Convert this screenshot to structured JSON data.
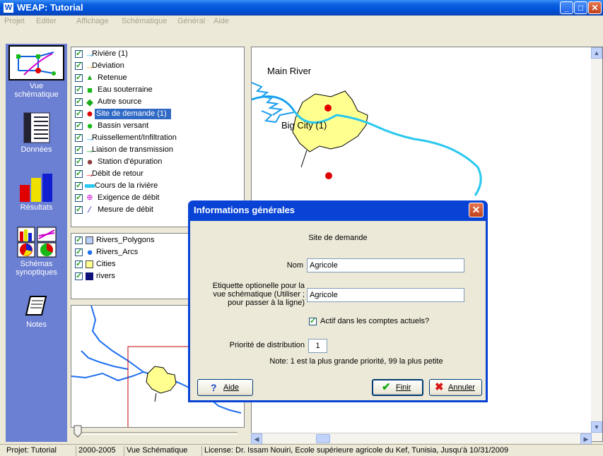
{
  "window": {
    "title": "WEAP: Tutorial",
    "icon_letter": "W"
  },
  "menu": [
    "Projet",
    "Editer",
    "Affichage",
    "Schématique",
    "Général",
    "Aide"
  ],
  "sidebar": [
    {
      "label_1": "Vue",
      "label_2": "schématique",
      "icon": "schematic-icon"
    },
    {
      "label_1": "Données",
      "icon": "data-icon"
    },
    {
      "label_1": "Résultats",
      "icon": "results-icon"
    },
    {
      "label_1": "Schémas",
      "label_2": "synoptiques",
      "icon": "overviews-icon"
    },
    {
      "label_1": "Notes",
      "icon": "notes-icon"
    }
  ],
  "legend": [
    {
      "label": "Rivière (1)",
      "symbol": "river-arrow-icon",
      "color": "#29a9f2"
    },
    {
      "label": "Déviation",
      "symbol": "diversion-arrow-icon",
      "color": "#f59a20"
    },
    {
      "label": "Retenue",
      "symbol": "reservoir-triangle-icon",
      "color": "#18a818"
    },
    {
      "label": "Eau souterraine",
      "symbol": "groundwater-square-icon",
      "color": "#18b818"
    },
    {
      "label": "Autre source",
      "symbol": "other-supply-diamond-icon",
      "color": "#18a818"
    },
    {
      "label": "Site de demande (1)",
      "symbol": "demand-site-dot-icon",
      "color": "#e00000",
      "selected": true
    },
    {
      "label": "Bassin versant",
      "symbol": "catchment-dot-icon",
      "color": "#18b818"
    },
    {
      "label": "Ruissellement/Infiltration",
      "symbol": "runoff-arrow-icon",
      "color": "#29a9f2"
    },
    {
      "label": "Liaison de transmission",
      "symbol": "transmission-arrow-icon",
      "color": "#18a818"
    },
    {
      "label": "Station d'épuration",
      "symbol": "treatment-dot-icon",
      "color": "#8b3a3a"
    },
    {
      "label": "Débit de retour",
      "symbol": "return-flow-arrow-icon",
      "color": "#e00000"
    },
    {
      "label": "Cours de la rivière",
      "symbol": "reach-bar-icon",
      "color": "#29c8f0"
    },
    {
      "label": "Exigence de débit",
      "symbol": "flow-requirement-icon",
      "color": "#d000d0"
    },
    {
      "label": "Mesure de débit",
      "symbol": "streamflow-gauge-icon",
      "color": "#1010c0"
    }
  ],
  "layers": [
    {
      "label": "Rivers_Polygons",
      "symbol": "polygon-square-icon",
      "color": "#b8d0f8"
    },
    {
      "label": "Rivers_Arcs",
      "symbol": "arc-dot-icon",
      "color": "#1e6ef0"
    },
    {
      "label": "Cities",
      "symbol": "city-square-icon",
      "color": "#ffff90"
    },
    {
      "label": "rivers",
      "symbol": "rivers-square-icon",
      "color": "#10107a"
    }
  ],
  "map": {
    "river_label": "Main River",
    "city_label": "Big City (1)"
  },
  "dialog": {
    "title": "Informations générales",
    "subtitle": "Site de demande",
    "name_label": "Nom",
    "name_value": "Agricole",
    "optional_label_1": "Etiquette optionelle pour la",
    "optional_label_2": "vue schématique (Utiliser ;",
    "optional_label_3": "pour passer à la ligne)",
    "optional_value": "Agricole",
    "active_label": "Actif dans les comptes actuels?",
    "priority_label": "Priorité de distribution",
    "priority_value": "1",
    "note": "Note: 1 est la plus grande priorité, 99 la plus petite",
    "help_button": "Aide",
    "ok_button": "Finir",
    "cancel_button": "Annuler"
  },
  "status": [
    "Projet: Tutorial",
    "2000-2005",
    "Vue Schématique",
    "License: Dr. Issam Nouiri, Ecole supérieure agricole du Kef, Tunisia, Jusqu'à 10/31/2009"
  ]
}
